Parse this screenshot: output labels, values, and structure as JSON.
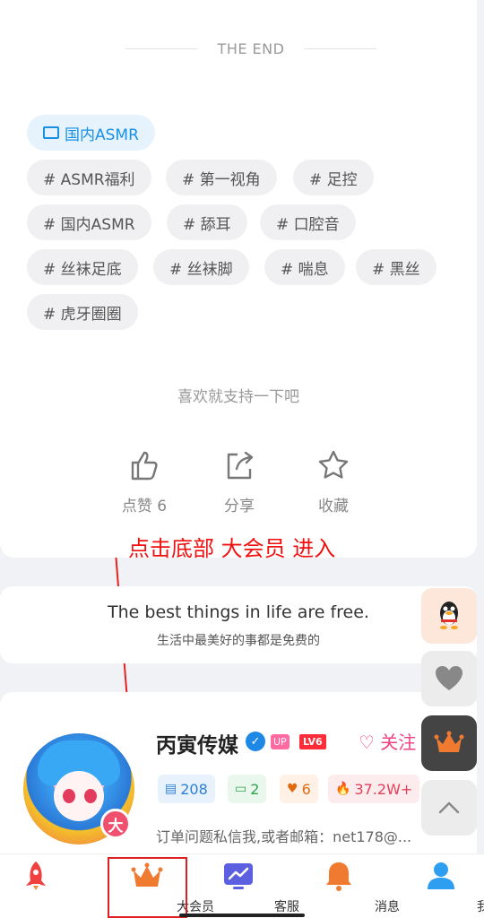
{
  "end_text": "THE END",
  "category": {
    "label": "国内ASMR"
  },
  "tags": [
    "# ASMR福利",
    "# 第一视角",
    "# 足控",
    "# 国内ASMR",
    "# 舔耳",
    "# 口腔音",
    "# 丝袜足底",
    "# 丝袜脚",
    "# 喘息",
    "# 黑丝",
    "# 虎牙圈圈"
  ],
  "support_text": "喜欢就支持一下吧",
  "actions": {
    "like": "点赞 6",
    "share": "分享",
    "favorite": "收藏"
  },
  "annotation": "点击底部 大会员 进入",
  "quote": {
    "en": "The best things in life are free.",
    "cn": "生活中最美好的事都是免费的"
  },
  "author": {
    "name": "丙寅传媒",
    "up_badge": "UP",
    "level_badge": "LV6",
    "follow_label": "♡ 关注",
    "avatar_badge": "大",
    "stats": {
      "posts": "208",
      "comments": "2",
      "likes": "6",
      "heat": "37.2W+"
    },
    "bio": "订单问题私信我,或者邮箱：net178@..."
  },
  "nav": {
    "home": "",
    "vip": "大会员",
    "service": "客服",
    "messages": "消息",
    "mine": "我的"
  },
  "colors": {
    "accent": "#1890e8",
    "annotation_red": "#f01010",
    "vip_orange": "#f07a30"
  }
}
